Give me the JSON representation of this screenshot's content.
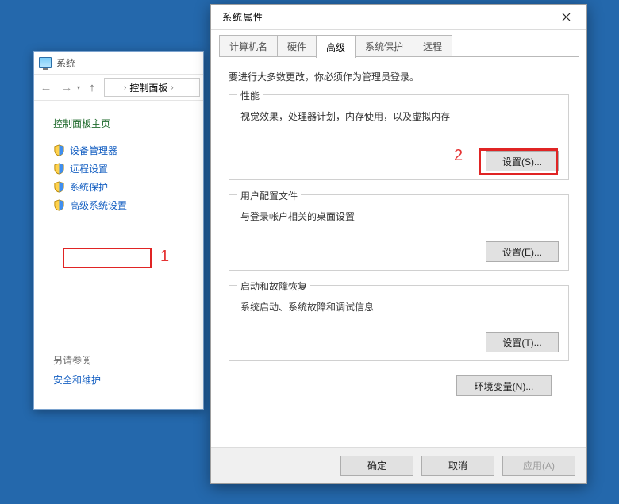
{
  "annotations": {
    "one": "1",
    "two": "2"
  },
  "control_panel": {
    "title": "系统",
    "breadcrumb_item": "控制面板",
    "side_heading": "控制面板主页",
    "items": [
      {
        "label": "设备管理器"
      },
      {
        "label": "远程设置"
      },
      {
        "label": "系统保护"
      },
      {
        "label": "高级系统设置"
      }
    ],
    "see_also_heading": "另请参阅",
    "see_also_item": "安全和维护"
  },
  "dialog": {
    "title": "系统属性",
    "tabs": [
      {
        "label": "计算机名",
        "active": false
      },
      {
        "label": "硬件",
        "active": false
      },
      {
        "label": "高级",
        "active": true
      },
      {
        "label": "系统保护",
        "active": false
      },
      {
        "label": "远程",
        "active": false
      }
    ],
    "intro": "要进行大多数更改，你必须作为管理员登录。",
    "groups": {
      "performance": {
        "legend": "性能",
        "desc": "视觉效果，处理器计划，内存使用，以及虚拟内存",
        "button": "设置(S)..."
      },
      "profiles": {
        "legend": "用户配置文件",
        "desc": "与登录帐户相关的桌面设置",
        "button": "设置(E)..."
      },
      "startup": {
        "legend": "启动和故障恢复",
        "desc": "系统启动、系统故障和调试信息",
        "button": "设置(T)..."
      }
    },
    "env_btn": "环境变量(N)...",
    "footer": {
      "ok": "确定",
      "cancel": "取消",
      "apply": "应用(A)"
    }
  }
}
